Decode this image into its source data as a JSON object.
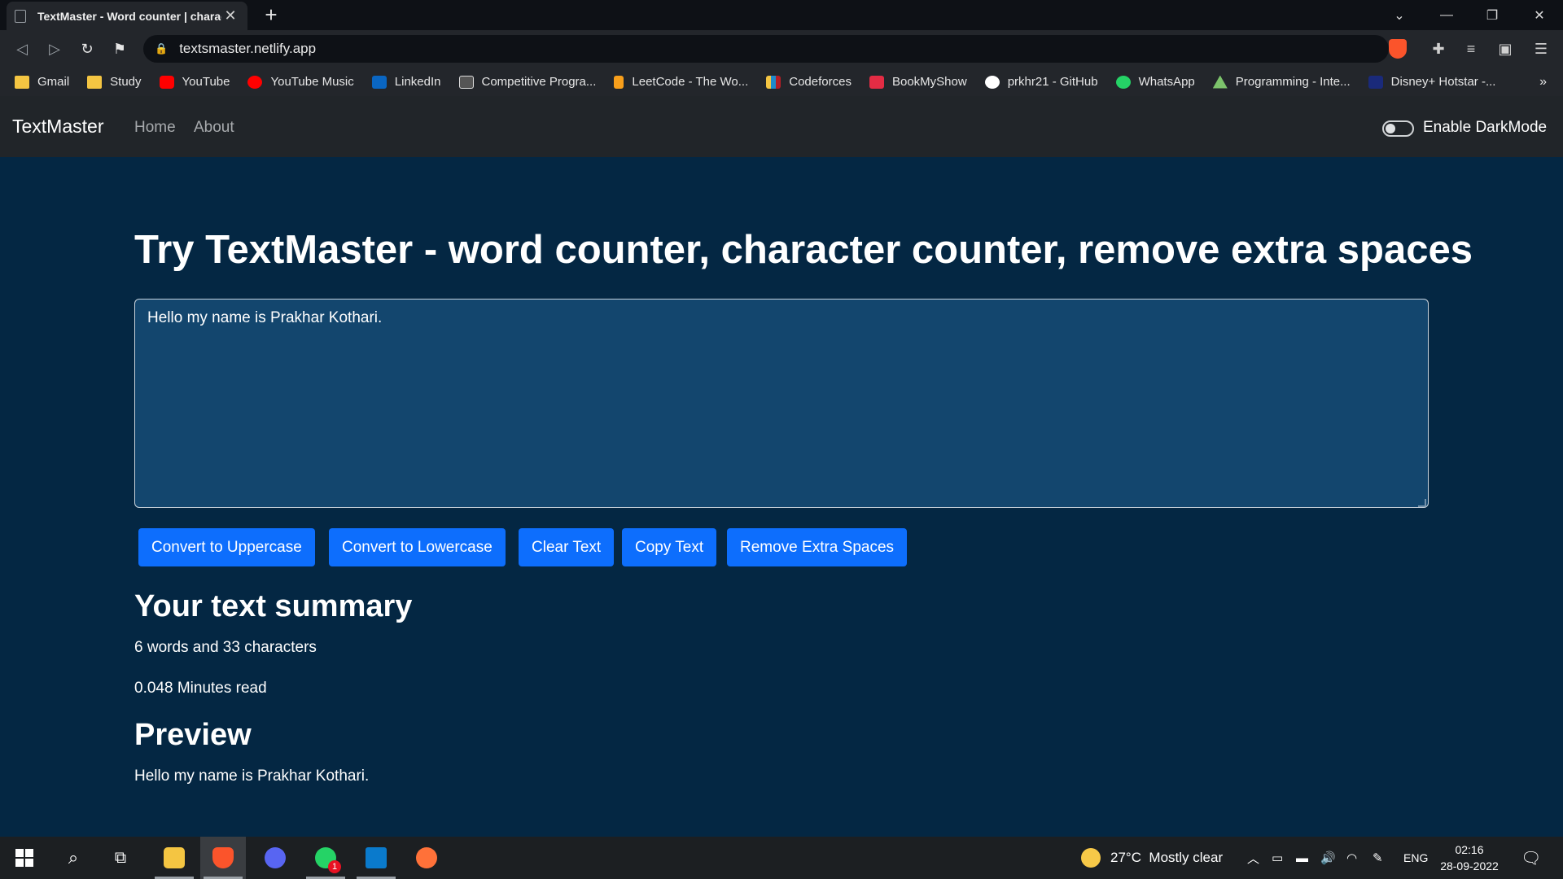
{
  "browser": {
    "tab_title": "TextMaster - Word counter | character counter",
    "url": "textsmaster.netlify.app",
    "bookmarks": [
      {
        "label": "Gmail",
        "icon": "folder-icon"
      },
      {
        "label": "Study",
        "icon": "folder-icon"
      },
      {
        "label": "YouTube",
        "icon": "youtube-icon"
      },
      {
        "label": "YouTube Music",
        "icon": "youtube-music-icon"
      },
      {
        "label": "LinkedIn",
        "icon": "linkedin-icon"
      },
      {
        "label": "Competitive Progra...",
        "icon": "codechef-icon"
      },
      {
        "label": "LeetCode - The Wo...",
        "icon": "leetcode-icon"
      },
      {
        "label": "Codeforces",
        "icon": "codeforces-icon"
      },
      {
        "label": "BookMyShow",
        "icon": "bookmyshow-icon"
      },
      {
        "label": "prkhr21 - GitHub",
        "icon": "github-icon"
      },
      {
        "label": "WhatsApp",
        "icon": "whatsapp-icon"
      },
      {
        "label": "Programming - Inte...",
        "icon": "mountain-icon"
      },
      {
        "label": "Disney+ Hotstar -...",
        "icon": "hotstar-icon"
      }
    ]
  },
  "app": {
    "brand": "TextMaster",
    "nav": {
      "home": "Home",
      "about": "About"
    },
    "darkmode_label": "Enable DarkMode",
    "heading": "Try TextMaster - word counter, character counter, remove extra spaces",
    "textarea_value": "Hello my name is Prakhar Kothari.",
    "buttons": {
      "uppercase": "Convert to Uppercase",
      "lowercase": "Convert to Lowercase",
      "clear": "Clear Text",
      "copy": "Copy Text",
      "remove_spaces": "Remove Extra Spaces"
    },
    "summary_title": "Your text summary",
    "summary_counts": "6 words and 33 characters",
    "read_time": "0.048 Minutes read",
    "preview_title": "Preview",
    "preview_text": "Hello my name is Prakhar Kothari."
  },
  "taskbar": {
    "weather": "27°C  Mostly clear",
    "language": "ENG",
    "time": "02:16",
    "date": "28-09-2022",
    "whatsapp_badge": "1"
  },
  "colors": {
    "page_bg": "#042743",
    "textarea_bg": "#13466e",
    "navbar_bg": "#212529",
    "button_blue": "#0d6efd"
  }
}
